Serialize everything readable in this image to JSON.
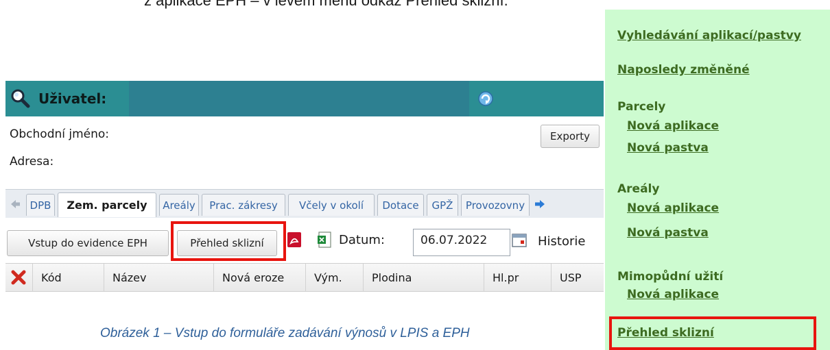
{
  "top_text": "z aplikace EPH – v levém menu odkaz Přehled sklizní.",
  "header": {
    "user_label": "Uživatel:"
  },
  "info": {
    "business_name_label": "Obchodní jméno:",
    "address_label": "Adresa:",
    "exports_button": "Exporty"
  },
  "tabs": [
    {
      "label": "DPB"
    },
    {
      "label": "Zem. parcely",
      "active": true
    },
    {
      "label": "Areály"
    },
    {
      "label": "Prac. zákresy"
    },
    {
      "label": "Včely v okolí"
    },
    {
      "label": "Dotace"
    },
    {
      "label": "GPŽ"
    },
    {
      "label": "Provozovny"
    }
  ],
  "toolbar": {
    "enter_eph_button": "Vstup do evidence EPH",
    "harvest_overview_button": "Přehled sklizní",
    "date_label": "Datum:",
    "date_value": "06.07.2022",
    "history_label": "Historie"
  },
  "table": {
    "columns": [
      "Kód",
      "Název",
      "Nová eroze",
      "Vým.",
      "Plodina",
      "Hl.pr",
      "USP"
    ]
  },
  "menu": {
    "search_link": "Vyhledávání aplikací/pastvy",
    "recent_link": "Naposledy změněné",
    "parcels_heading": "Parcely",
    "parcels_new_app": "Nová aplikace",
    "parcels_new_pasture": "Nová pastva",
    "areas_heading": "Areály",
    "areas_new_app": "Nová aplikace",
    "areas_new_pasture": "Nová pastva",
    "nonagri_heading": "Mimopůdní užití",
    "nonagri_new_app": "Nová aplikace",
    "harvest_link": "Přehled sklizní"
  },
  "caption": "Obrázek 1 – Vstup do formuláře zadávání výnosů v LPIS a EPH",
  "colors": {
    "menu_bg": "#cdfbd0",
    "menu_link": "#3d6b21",
    "header_bg": "#2b8e93",
    "highlight": "#e8140e",
    "caption": "#2e5f99"
  }
}
